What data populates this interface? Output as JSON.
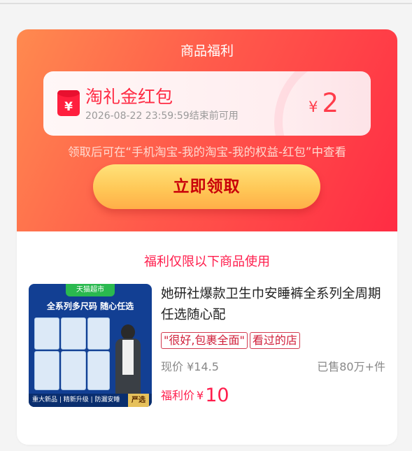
{
  "header": {
    "title": "商品福利"
  },
  "coupon": {
    "envelope_icon": "red-envelope-icon",
    "envelope_symbol": "¥",
    "name": "淘礼金红包",
    "expire_text": "2026-08-22 23:59:59结束前可用",
    "currency": "¥",
    "amount": "2"
  },
  "tip": "领取后可在“手机淘宝-我的淘宝-我的权益-红包”中查看",
  "claim_button": "立即领取",
  "section_title": "福利仅限以下商品使用",
  "product": {
    "image_badge": "天猫超市",
    "image_banner": "全系列多尺码 随心任选",
    "image_footer_left": "重大新品 | 精新升级 | 防漏安睡",
    "image_footer_right": "严选",
    "title": "她研社爆款卫生巾安睡裤全系列全周期任选随心配",
    "tags": [
      "\"很好,包裹全面\"",
      "看过的店"
    ],
    "now_price_label": "现价",
    "now_price": "¥14.5",
    "sold": "已售80万+件",
    "benefit_label": "福利价",
    "benefit_currency": "¥",
    "benefit_price": "10"
  },
  "colors": {
    "header_gradient_start": "#ff8a4f",
    "header_gradient_end": "#ff2c44",
    "accent_red": "#ff1d4c",
    "button_yellow": "#ffc857",
    "button_text": "#c9000a"
  }
}
